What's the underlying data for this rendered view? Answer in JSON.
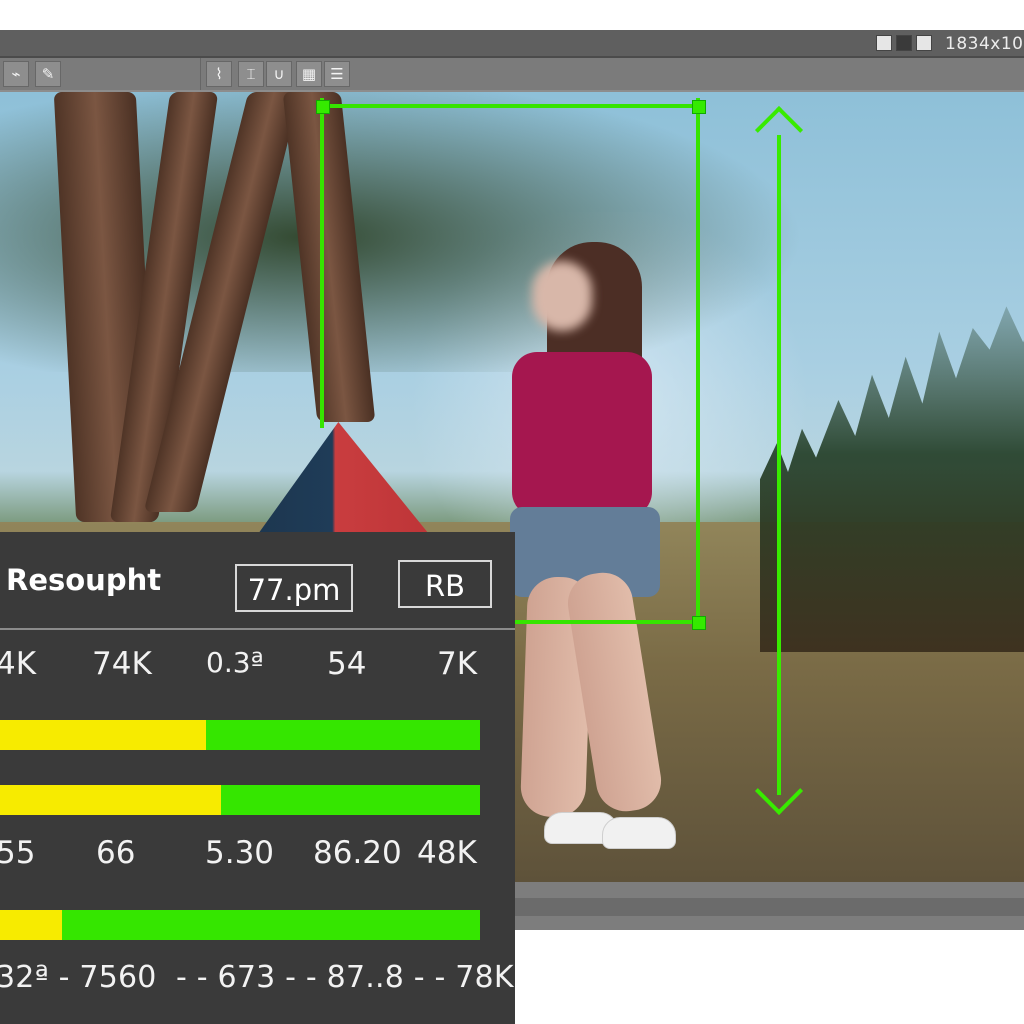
{
  "window": {
    "dimensions_text": "1834x10"
  },
  "toolbar": {
    "left_icons": [
      "lasso-icon",
      "pen-icon",
      "brush-icon"
    ],
    "middle_icons": [
      "lamp-icon",
      "tool-icon",
      "u-tool-icon",
      "grid-icon",
      "stack-icon"
    ]
  },
  "panel": {
    "title": "Resoupht",
    "time_box": "77.pm",
    "mode_box": "RB",
    "row1": [
      "4K",
      "74K",
      "0.3ª",
      "54",
      "7K"
    ],
    "row2": [
      "55",
      "66",
      "5.30",
      "86.20",
      "48K"
    ],
    "row3": "32ª - 7560  - - 673 - - 87..8 - - 78K",
    "progress": [
      {
        "yellow_fraction": 0.43
      },
      {
        "yellow_fraction": 0.46
      },
      {
        "yellow_fraction": 0.13
      }
    ]
  },
  "colors": {
    "selection": "#36e400",
    "bar_yellow": "#f7eb00",
    "bar_green": "#35e600"
  }
}
